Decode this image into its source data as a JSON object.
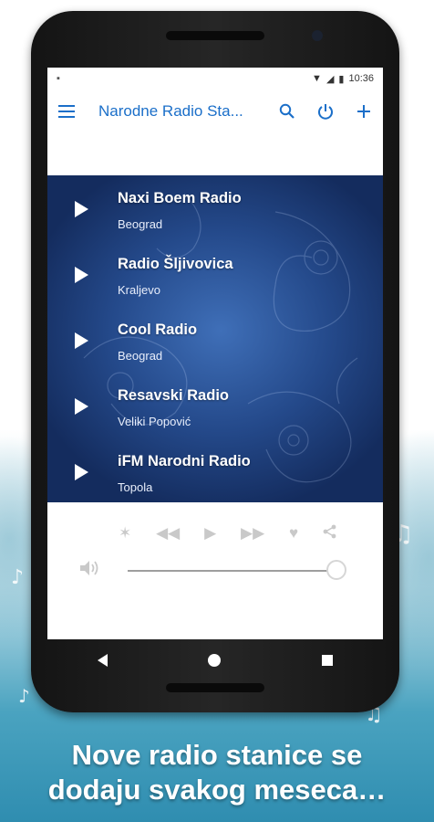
{
  "status_bar": {
    "time": "10:36"
  },
  "toolbar": {
    "title": "Narodne Radio Sta..."
  },
  "stations": [
    {
      "name": "Naxi Boem Radio",
      "city": "Beograd"
    },
    {
      "name": "Radio Šljivovica",
      "city": "Kraljevo"
    },
    {
      "name": "Cool Radio",
      "city": "Beograd"
    },
    {
      "name": "Resavski Radio",
      "city": "Veliki Popović"
    },
    {
      "name": "iFM Narodni Radio",
      "city": "Topola"
    }
  ],
  "player": {
    "volume_level": 0.98
  },
  "promo": {
    "line1": "Nove radio stanice se",
    "line2": "dodaju svakog meseca…"
  },
  "colors": {
    "accent": "#1b6fc9",
    "list_bg": "#24498a",
    "splash": "#2f8db0"
  }
}
